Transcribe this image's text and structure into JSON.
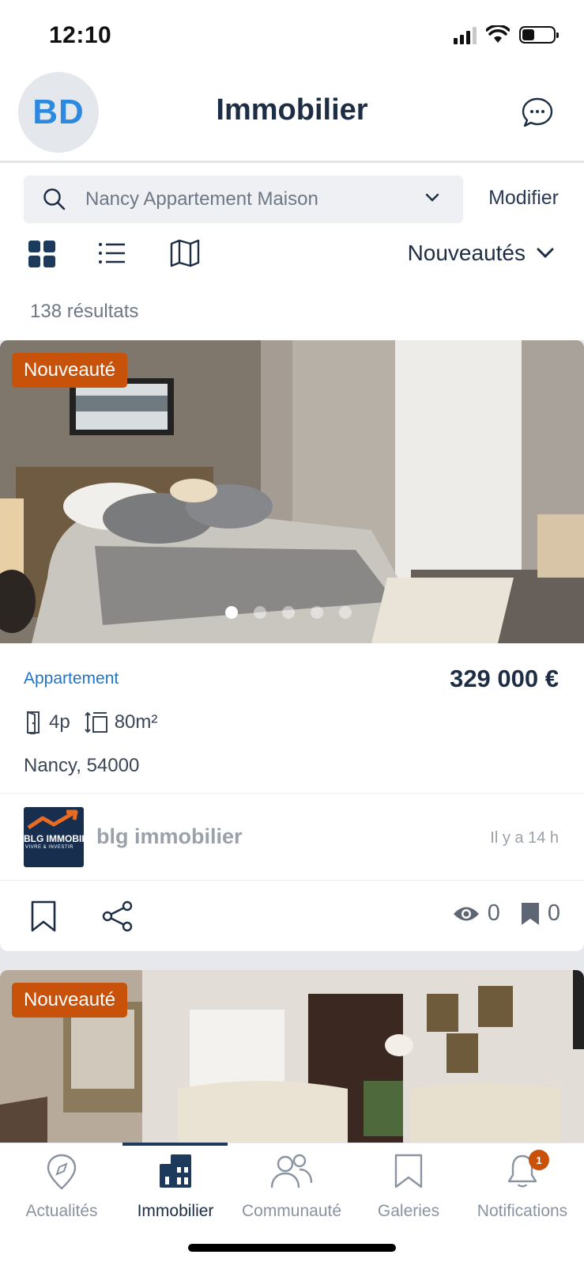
{
  "status_bar": {
    "time": "12:10"
  },
  "header": {
    "avatar_initials": "BD",
    "title": "Immobilier"
  },
  "search": {
    "query": "Nancy Appartement Maison",
    "modify_label": "Modifier"
  },
  "sort": {
    "label": "Nouveautés"
  },
  "results": {
    "count_label": "138 résultats"
  },
  "listings": [
    {
      "badge": "Nouveauté",
      "type": "Appartement",
      "price": "329 000 €",
      "rooms": "4p",
      "area": "80m²",
      "location": "Nancy, 54000",
      "agency_name": "blg immobilier",
      "agency_logo_text": "BLG IMMOBILIER",
      "agency_logo_subtext": "VIVRE & INVESTIR",
      "time_ago": "Il y a 14 h",
      "views": "0",
      "saves": "0",
      "photo_count": 5,
      "photo_active_index": 0
    },
    {
      "badge": "Nouveauté"
    }
  ],
  "bottom_nav": {
    "items": [
      {
        "label": "Actualités",
        "icon": "location-pin-icon"
      },
      {
        "label": "Immobilier",
        "icon": "buildings-icon",
        "active": true
      },
      {
        "label": "Communauté",
        "icon": "people-icon"
      },
      {
        "label": "Galeries",
        "icon": "bookmark-icon"
      },
      {
        "label": "Notifications",
        "icon": "bell-icon",
        "badge": "1"
      }
    ]
  },
  "colors": {
    "accent_orange": "#c9520b",
    "navy": "#1d2d44",
    "link_blue": "#1f74c8"
  }
}
